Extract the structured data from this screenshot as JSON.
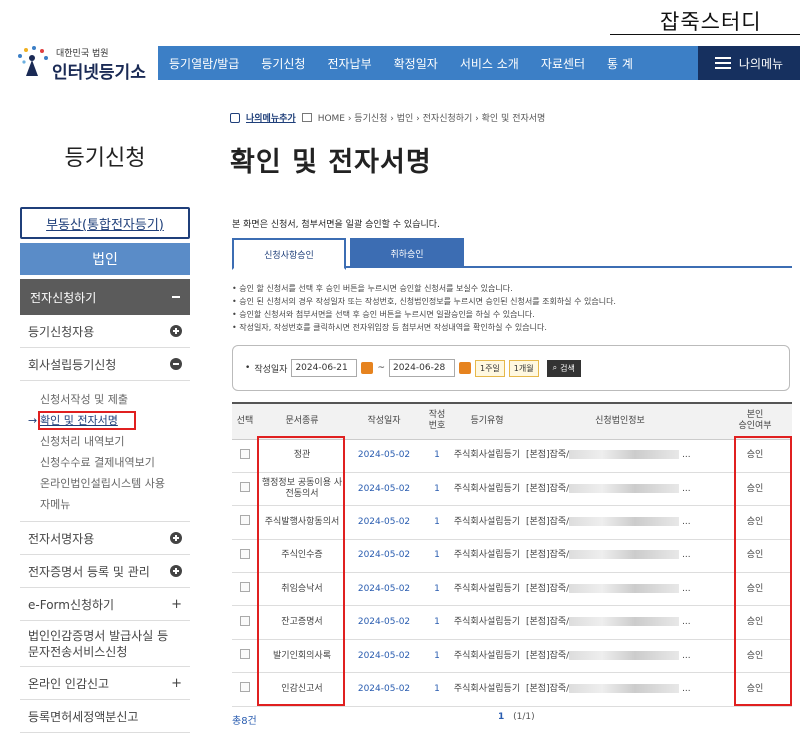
{
  "watermark": "잡죽스터디",
  "logo": {
    "sub": "대한민국 법원",
    "main": "인터넷등기소"
  },
  "gnb": {
    "items": [
      "등기열람/발급",
      "등기신청",
      "전자납부",
      "확정일자",
      "서비스 소개",
      "자료센터",
      "통 계"
    ],
    "my_menu": "나의메뉴"
  },
  "breadcrumb": {
    "favorite": "나의메뉴추가",
    "path": "HOME › 등기신청 › 법인 › 전자신청하기 › 확인 및 전자서명"
  },
  "sidebar": {
    "title": "등기신청",
    "top_link": "부동산(통합전자등기)",
    "category": "법인",
    "section": "전자신청하기",
    "rows1": [
      "등기신청자용",
      "회사설립등기신청"
    ],
    "sub_items": [
      "신청서작성 및 제출",
      "확인 및 전자서명",
      "신청처리 내역보기",
      "신청수수료 결제내역보기",
      "온라인법인설립시스템 사용",
      "자메뉴"
    ],
    "rows2": [
      "전자서명자용",
      "전자증명서 등록 및 관리"
    ],
    "rows3": [
      "e-Form신청하기",
      "법인인감증명서 발급사실 등 문자전송서비스신청",
      "온라인 인감신고",
      "등록면허세정액분신고"
    ]
  },
  "main": {
    "title": "확인 및 전자서명",
    "intro": "본 화면은 신청서, 첨부서면을 일괄 승인할 수 있습니다.",
    "tabs": [
      "신청사항승인",
      "취하승인"
    ],
    "notes": [
      "승인 할 신청서를 선택 후 승인 버튼을 누르시면 승인할 신청서를 보실수 있습니다.",
      "승인 된 신청서의 경우 작성일자 또는 작성번호, 신청법인정보를 누르시면 승인된 신청서를 조회하실 수 있습니다.",
      "승인할 신청서와 첨부서면을 선택 후 승인 버튼을 누르시면 일괄승인을 하실 수 있습니다.",
      "작성일자, 작성번호를 클릭하시면 전자위임장 등 첨부서면 작성내역을 확인하실 수 있습니다."
    ],
    "search": {
      "label": "작성일자",
      "from": "2024-06-21",
      "tilde": "~",
      "to": "2024-06-28",
      "week": "1주일",
      "month": "1개월",
      "button": "검색"
    },
    "table": {
      "headers": [
        "선택",
        "문서종류",
        "작성일자",
        "작성\n번호",
        "등기유형",
        "신청법인정보",
        "본인\n승인여부"
      ],
      "rows": [
        {
          "doc": "정관",
          "date": "2024-05-02",
          "no": "1",
          "type": "주식회사설립등기",
          "info": "[본점]잡죽/",
          "ellipsis": "...",
          "status": "승인"
        },
        {
          "doc": "행정정보 공동이용 사전동의서",
          "date": "2024-05-02",
          "no": "1",
          "type": "주식회사설립등기",
          "info": "[본점]잡죽/",
          "ellipsis": "...",
          "status": "승인"
        },
        {
          "doc": "주식발행사항동의서",
          "date": "2024-05-02",
          "no": "1",
          "type": "주식회사설립등기",
          "info": "[본점]잡죽/",
          "ellipsis": "...",
          "status": "승인"
        },
        {
          "doc": "주식인수증",
          "date": "2024-05-02",
          "no": "1",
          "type": "주식회사설립등기",
          "info": "[본점]잡죽/",
          "ellipsis": "...",
          "status": "승인"
        },
        {
          "doc": "취임승낙서",
          "date": "2024-05-02",
          "no": "1",
          "type": "주식회사설립등기",
          "info": "[본점]잡죽/",
          "ellipsis": "...",
          "status": "승인"
        },
        {
          "doc": "잔고증명서",
          "date": "2024-05-02",
          "no": "1",
          "type": "주식회사설립등기",
          "info": "[본점]잡죽/",
          "ellipsis": "...",
          "status": "승인"
        },
        {
          "doc": "발기인회의사록",
          "date": "2024-05-02",
          "no": "1",
          "type": "주식회사설립등기",
          "info": "[본점]잡죽/",
          "ellipsis": "...",
          "status": "승인"
        },
        {
          "doc": "인감신고서",
          "date": "2024-05-02",
          "no": "1",
          "type": "주식회사설립등기",
          "info": "[본점]잡죽/",
          "ellipsis": "...",
          "status": "승인"
        }
      ]
    },
    "total": "총8건",
    "pager": {
      "current": "1",
      "range": "(1/1)"
    }
  }
}
